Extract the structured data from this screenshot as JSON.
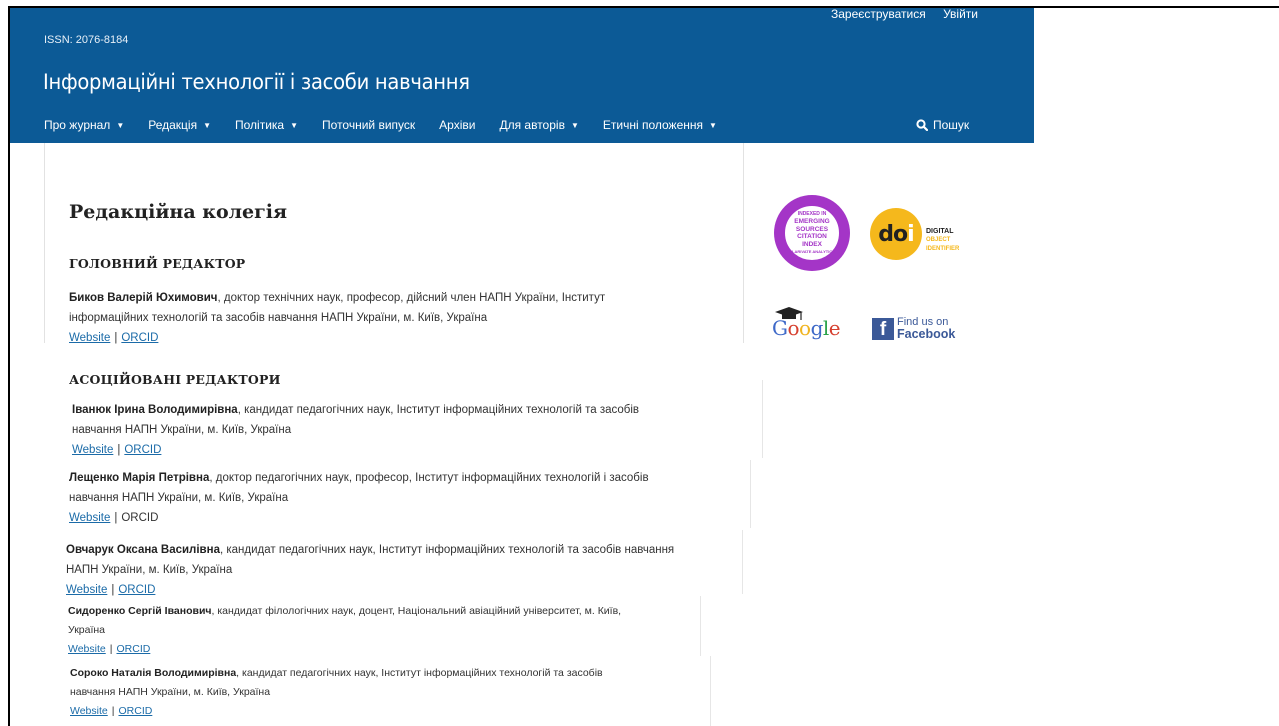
{
  "header": {
    "issn": "ISSN: 2076-8184",
    "title": "Інформаційні технології і засоби навчання",
    "user_nav": [
      "Зареєструватися",
      "Увійти"
    ],
    "search_label": "Пошук",
    "bg_color": "#0c5a96"
  },
  "nav": [
    {
      "label": "Про журнал",
      "dropdown": true
    },
    {
      "label": "Редакція",
      "dropdown": true
    },
    {
      "label": "Політика",
      "dropdown": true
    },
    {
      "label": "Поточний випуск",
      "dropdown": false
    },
    {
      "label": "Архіви",
      "dropdown": false
    },
    {
      "label": "Для авторів",
      "dropdown": true
    },
    {
      "label": "Етичні положення",
      "dropdown": true
    }
  ],
  "page": {
    "title": "Редакційна колегія",
    "chief_heading": "ГОЛОВНИЙ РЕДАКТОР",
    "associate_heading": "АСОЦІЙОВАНІ РЕДАКТОРИ"
  },
  "chief": {
    "name": "Биков Валерій Юхимович",
    "desc_line1": ", доктор технічних наук, професор, дійсний член НАПН України, Інститут",
    "desc_line2": "інформаційних технологій та засобів навчання НАПН України, м. Київ, Україна",
    "website": "Website",
    "orcid": "ORCID",
    "sep": "|"
  },
  "associates": [
    {
      "name": "Іванюк Ірина Володимирівна",
      "desc_line1": ", кандидат педагогічних наук, Інститут інформаційних технологій та засобів",
      "desc_line2": "навчання НАПН України, м. Київ, Україна",
      "website": "Website",
      "orcid": "ORCID",
      "sep": "|"
    },
    {
      "name": "Лещенко Марія Петрівна",
      "desc_line1": ", доктор педагогічних наук, професор, Інститут інформаційних технологій і засобів",
      "desc_line2": "навчання НАПН України, м. Київ, Україна",
      "website": "Website",
      "orcid": "ORCID",
      "sep": "|"
    },
    {
      "name": "Овчарук Оксана Василівна",
      "desc_line1": ", кандидат педагогічних наук, Інститут інформаційних технологій та засобів навчання",
      "desc_line2": "НАПН України, м. Київ, Україна",
      "website": "Website",
      "orcid": "ORCID",
      "sep": "|"
    },
    {
      "name": "Сидоренко Сергій Іванович",
      "desc_line1": ", кандидат філологічних наук, доцент, Національний авіаційний університет, м. Київ,",
      "desc_line2": "Україна",
      "website": "Website",
      "orcid": "ORCID",
      "sep": "|"
    },
    {
      "name": "Сороко Наталія Володимирівна",
      "desc_line1": ", кандидат педагогічних наук, Інститут інформаційних технологій та засобів",
      "desc_line2": "навчання НАПН України, м. Київ, Україна",
      "website": "Website",
      "orcid": "ORCID",
      "sep": "|"
    }
  ],
  "sidebar": {
    "esci_lines": [
      "INDEXED IN",
      "EMERGING",
      "SOURCES",
      "CITATION",
      "INDEX",
      "CLARIVATE ANALYTICS"
    ],
    "doi_logo": "doi",
    "doi_labels": [
      "DIGITAL",
      "OBJECT",
      "IDENTIFIER"
    ],
    "google_logo": "Google",
    "facebook_line1": "Find us on",
    "facebook_line2": "Facebook",
    "facebook_icon": "f"
  }
}
